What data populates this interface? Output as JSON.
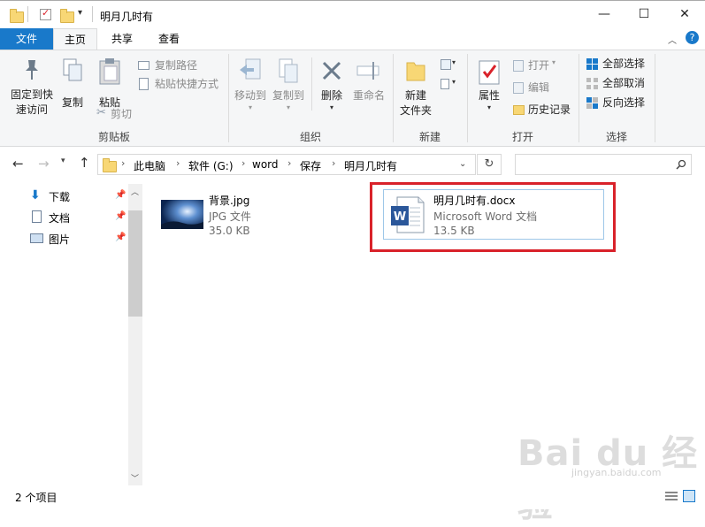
{
  "window": {
    "title": "明月几时有",
    "controls": {
      "minimize": "—",
      "maximize": "☐",
      "close": "✕"
    }
  },
  "ribbon_tabs": [
    {
      "label": "文件",
      "active": false
    },
    {
      "label": "主页",
      "active": true
    },
    {
      "label": "共享",
      "active": false
    },
    {
      "label": "查看",
      "active": false
    }
  ],
  "ribbon": {
    "clipboard": {
      "group_label": "剪贴板",
      "pin_quick_access_line1": "固定到快",
      "pin_quick_access_line2": "速访问",
      "copy": "复制",
      "paste": "粘贴",
      "copy_path": "复制路径",
      "paste_shortcut": "粘贴快捷方式",
      "cut": "剪切"
    },
    "organize": {
      "group_label": "组织",
      "move_to": "移动到",
      "copy_to": "复制到",
      "delete": "删除",
      "rename": "重命名"
    },
    "new": {
      "group_label": "新建",
      "new_folder_line1": "新建",
      "new_folder_line2": "文件夹"
    },
    "open": {
      "group_label": "打开",
      "properties": "属性",
      "open": "打开",
      "edit": "编辑",
      "history": "历史记录"
    },
    "select": {
      "group_label": "选择",
      "select_all": "全部选择",
      "select_none": "全部取消",
      "invert_selection": "反向选择"
    }
  },
  "address": {
    "breadcrumbs": [
      "此电脑",
      "软件 (G:)",
      "word",
      "保存",
      "明月几时有"
    ]
  },
  "nav_pane": {
    "items": [
      {
        "label": "下载",
        "pinned": true
      },
      {
        "label": "文档",
        "pinned": true
      },
      {
        "label": "图片",
        "pinned": true
      }
    ]
  },
  "files": [
    {
      "name": "背景.jpg",
      "type": "JPG 文件",
      "size": "35.0 KB"
    },
    {
      "name": "明月几时有.docx",
      "type": "Microsoft Word 文档",
      "size": "13.5 KB",
      "selected": true
    }
  ],
  "status": {
    "item_count": "2 个项目"
  },
  "watermark": {
    "brand": "Bai du 经验",
    "url": "jingyan.baidu.com"
  },
  "colors": {
    "file_tab_bg": "#1979ca",
    "highlight_border": "#d9222a",
    "selection_border": "#9ec7e8",
    "word_blue": "#2b579a"
  }
}
